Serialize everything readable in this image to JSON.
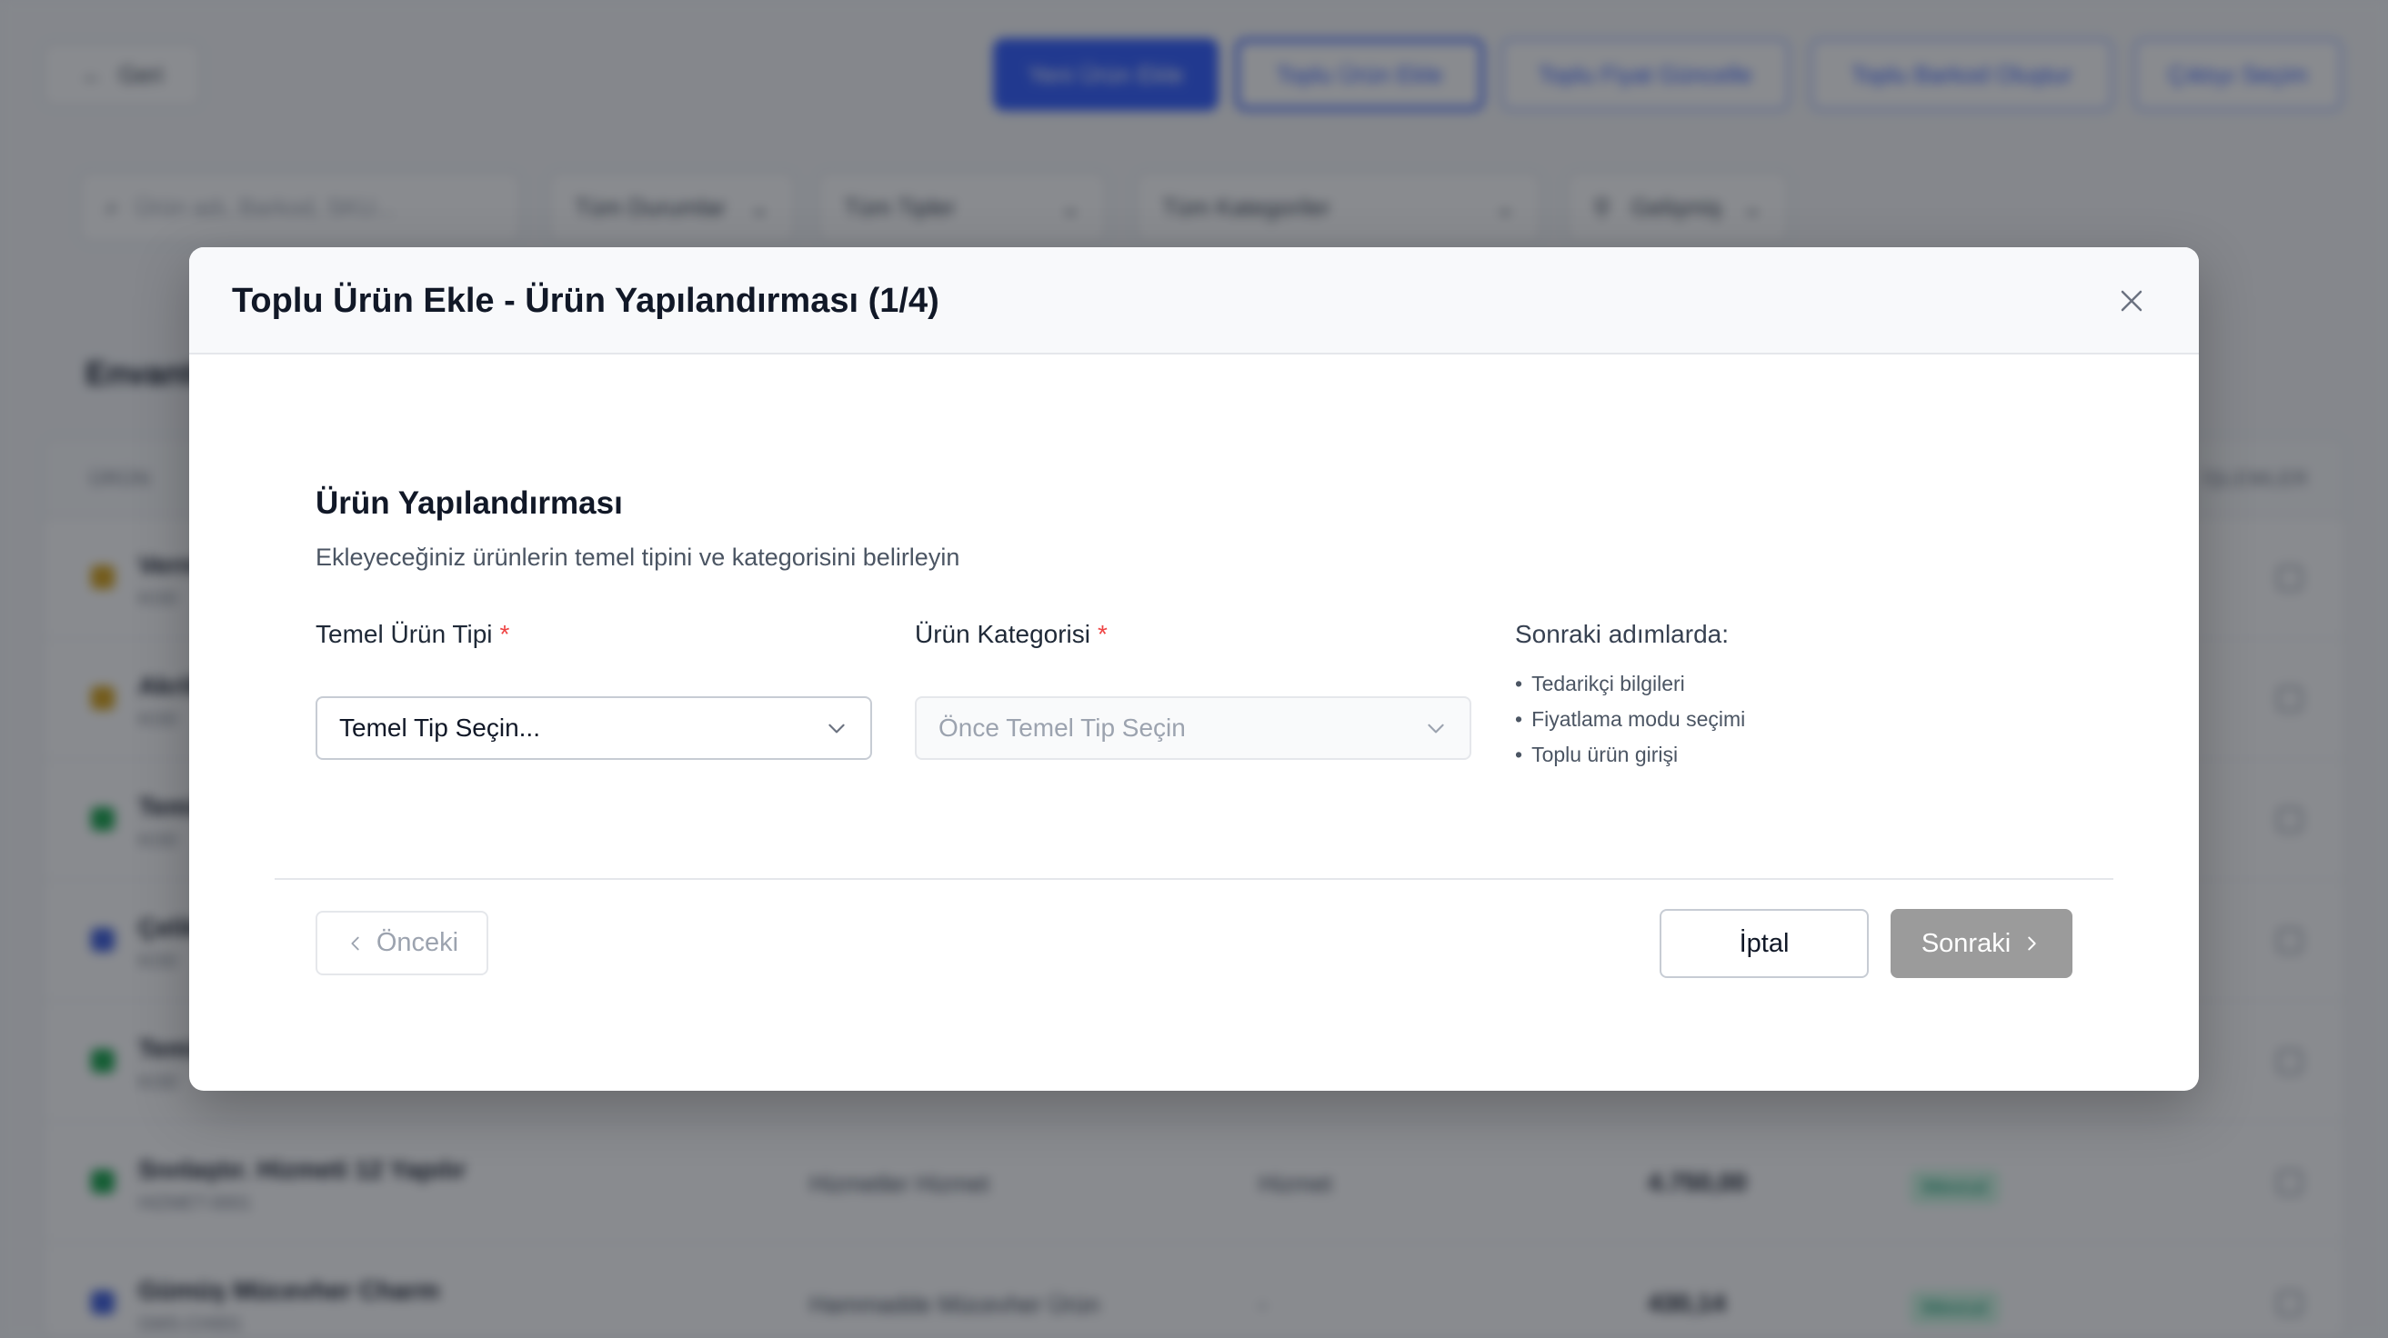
{
  "background": {
    "back_label": "Geri",
    "toolbar": [
      "Yeni Ürün Ekle",
      "Toplu Ürün Ekle",
      "Toplu Fiyat Güncelle",
      "Toplu Barkod Oluştur",
      "Çıktıyı Seçim"
    ],
    "search_placeholder": "Ürün adı, Barkod, SKU...",
    "filters": [
      "Tüm Durumlar",
      "Tüm Tipler",
      "Tüm Kategoriler",
      "Gelişmiş"
    ],
    "heading": "Envanter",
    "columns": [
      "ÜRÜN",
      "İŞLEMLER"
    ],
    "rows": [
      {
        "name": "Vernik",
        "sku": "KOD",
        "category": "",
        "price": "",
        "status": "",
        "color": "#d4a017"
      },
      {
        "name": "Akrilik",
        "sku": "KOD",
        "category": "",
        "price": "",
        "status": "",
        "color": "#d4a017"
      },
      {
        "name": "Temizlik",
        "sku": "KOD",
        "category": "",
        "price": "",
        "status": "",
        "color": "#16a34a"
      },
      {
        "name": "Çelik",
        "sku": "KOD",
        "category": "",
        "price": "",
        "status": "",
        "color": "#3b5bdb"
      },
      {
        "name": "Temizlik",
        "sku": "KOD",
        "category": "",
        "price": "",
        "status": "",
        "color": "#16a34a"
      },
      {
        "name": "Sıvılaştır. Hizmeti 12 Yapılır",
        "sku": "HIZMET-0001",
        "category": "Hizmetler Hizmet",
        "price": "Hizmet",
        "status": "Mevcut",
        "color": "#16a34a"
      },
      {
        "name": "Gümüş Mücevher Charm",
        "sku": "GMS-CH001",
        "category": "Hammadde Mücevher Ürün",
        "price": "-",
        "status": "Mevcut",
        "color": "#3b5bdb"
      }
    ],
    "row_values": [
      "4.750,00",
      "430,14"
    ]
  },
  "modal": {
    "title": "Toplu Ürün Ekle - Ürün Yapılandırması (1/4)",
    "section_title": "Ürün Yapılandırması",
    "section_description": "Ekleyeceğiniz ürünlerin temel tipini ve kategorisini belirleyin",
    "base_type": {
      "label": "Temel Ürün Tipi",
      "required_mark": "*",
      "value": "Temel Tip Seçin..."
    },
    "category": {
      "label": "Ürün Kategorisi",
      "required_mark": "*",
      "placeholder": "Önce Temel Tip Seçin"
    },
    "next_steps": {
      "title": "Sonraki adımlarda:",
      "items": [
        "Tedarikçi bilgileri",
        "Fiyatlama modu seçimi",
        "Toplu ürün girişi"
      ]
    },
    "buttons": {
      "previous": "Önceki",
      "cancel": "İptal",
      "next": "Sonraki"
    }
  }
}
